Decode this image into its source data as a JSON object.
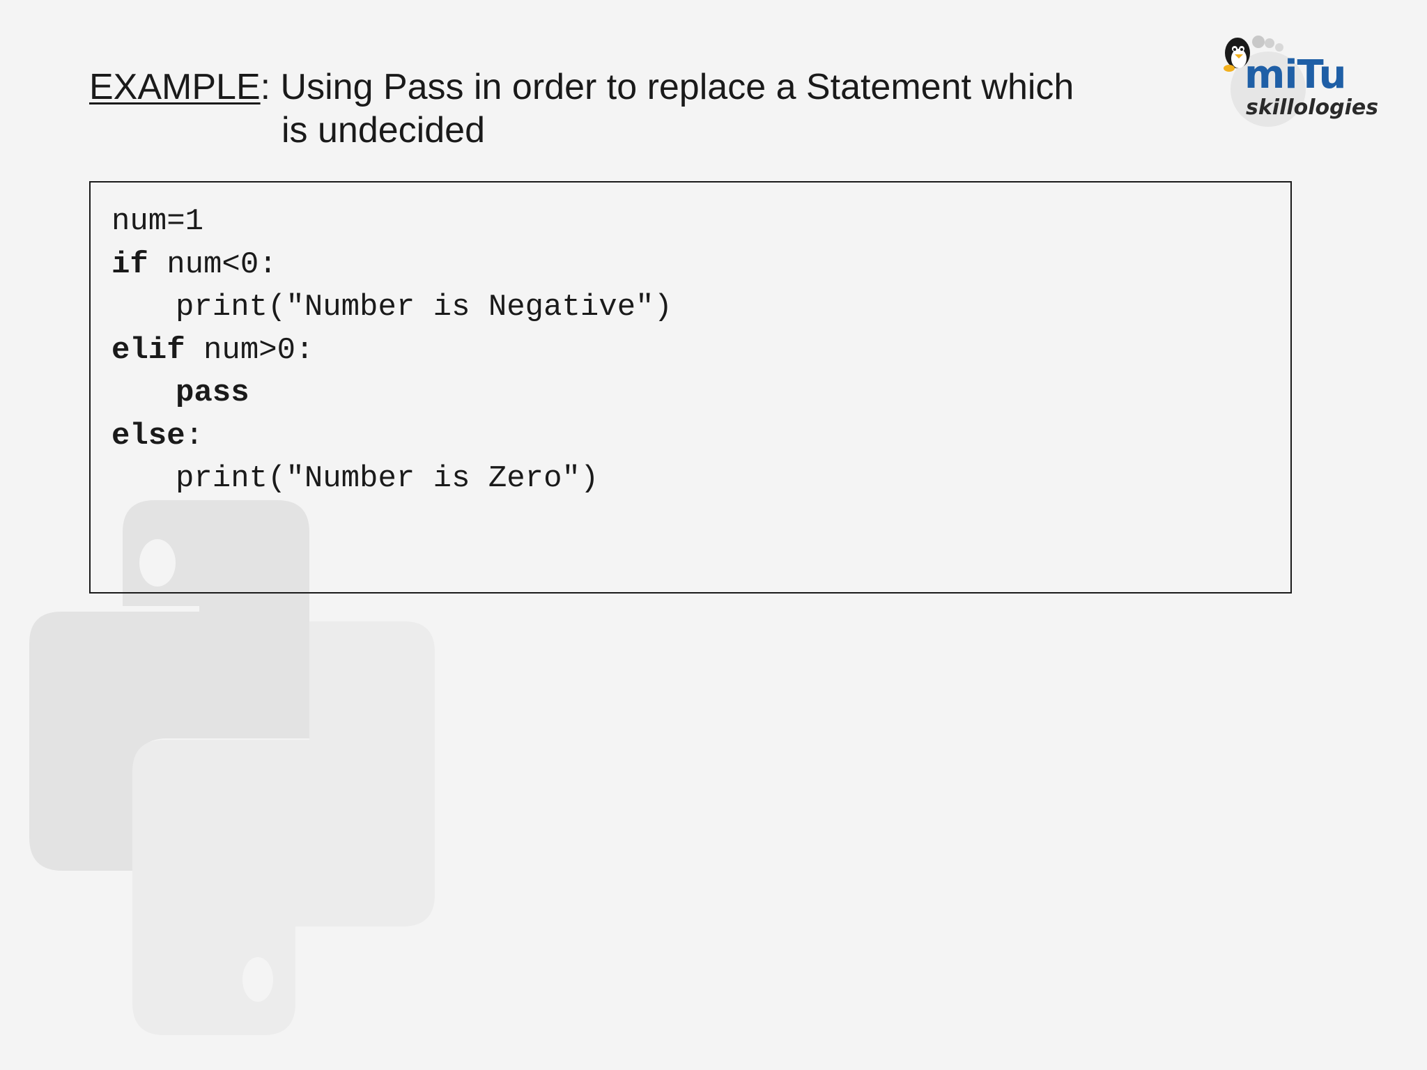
{
  "title": {
    "prefix": "EXAMPLE",
    "line1_rest": ": Using Pass in order to replace a Statement which",
    "line2": "is undecided"
  },
  "logo": {
    "brand": "miTu",
    "tagline": "skillologies"
  },
  "code": {
    "line1": "num=1",
    "line2_kw": "if",
    "line2_rest": " num<0:",
    "line3": "print(\"Number is Negative\")",
    "line4_kw": "elif",
    "line4_rest": " num>0:",
    "line5_kw": "pass",
    "line6_kw": "else",
    "line6_rest": ":",
    "line7": "print(\"Number is Zero\")"
  },
  "colors": {
    "background": "#f4f4f4",
    "text": "#1a1a1a",
    "logo_blue": "#1f5fa6",
    "watermark": "#e2e2e2"
  }
}
